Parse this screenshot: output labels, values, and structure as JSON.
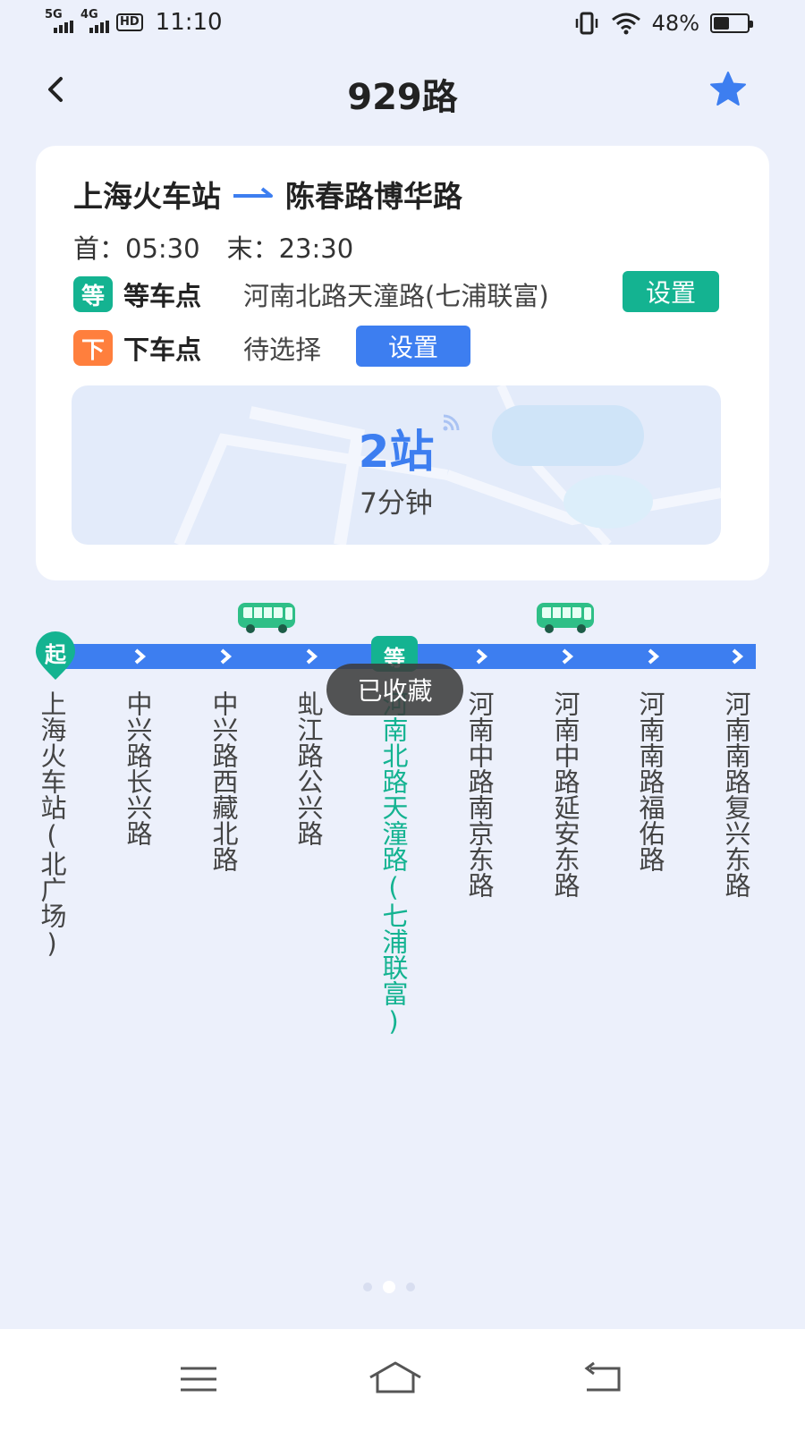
{
  "status_bar": {
    "network1": "5G",
    "network2": "4G",
    "hd": "HD",
    "time": "11:10",
    "battery": "48%"
  },
  "header": {
    "title": "929路"
  },
  "route_card": {
    "from": "上海火车站",
    "to": "陈春路博华路",
    "first_bus": "首：05:30",
    "last_bus": "末：23:30",
    "boarding": {
      "tag": "等",
      "label": "等车点",
      "value": "河南北路天潼路(七浦联富)",
      "button": "设置"
    },
    "alighting": {
      "tag": "下",
      "label": "下车点",
      "value": "待选择",
      "button": "设置"
    },
    "eta": {
      "stops": "2站",
      "minutes": "7分钟"
    }
  },
  "line": {
    "start_marker": "起",
    "wait_marker": "等",
    "stops": [
      "上海火车站(北广场)",
      "中兴路长兴路",
      "中兴路西藏北路",
      "虬江路公兴路",
      "河南北路天潼路(七浦联富)",
      "河南中路南京东路",
      "河南中路延安东路",
      "河南南路福佑路",
      "河南南路复兴东路"
    ]
  },
  "toast": "已收藏",
  "icons": {
    "back": "chevron-left-icon",
    "favorite": "star-icon",
    "bus": "bus-icon",
    "menu": "menu-icon",
    "home": "home-icon",
    "back_nav": "return-icon"
  },
  "colors": {
    "primary_blue": "#3d7ef0",
    "green": "#14b391",
    "orange": "#ff7f3d",
    "background": "#ecf0fb"
  }
}
